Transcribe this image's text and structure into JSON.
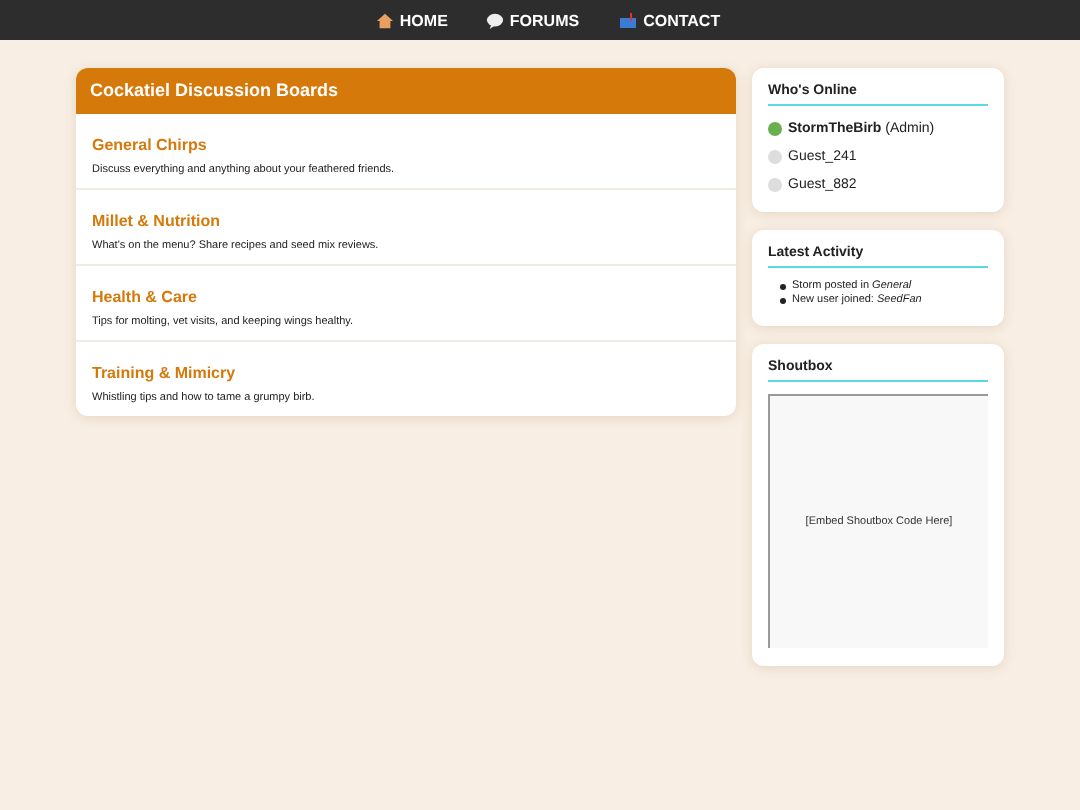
{
  "nav": [
    {
      "kind": "home",
      "label": "HOME"
    },
    {
      "kind": "forums",
      "label": "FORUMS"
    },
    {
      "kind": "contact",
      "label": "CONTACT"
    }
  ],
  "boards": {
    "title": "Cockatiel Discussion Boards",
    "items": [
      {
        "name": "General Chirps",
        "description": "Discuss everything and anything about your feathered friends."
      },
      {
        "name": "Millet & Nutrition",
        "description": "What's on the menu? Share recipes and seed mix reviews."
      },
      {
        "name": "Health & Care",
        "description": "Tips for molting, vet visits, and keeping wings healthy."
      },
      {
        "name": "Training & Mimicry",
        "description": "Whistling tips and how to tame a grumpy birb."
      }
    ]
  },
  "whos_online": {
    "title": "Who's Online",
    "users": [
      {
        "name": "**StormTheBirb** (Admin)",
        "color": "#6ab04c"
      },
      {
        "name": "Guest_241",
        "color": "#dddddd"
      },
      {
        "name": "Guest_882",
        "color": "#dddddd"
      }
    ]
  },
  "latest_activity": {
    "title": "Latest Activity",
    "items": [
      "Storm posted in *General*",
      "New user joined: *SeedFan*"
    ]
  },
  "shoutbox": {
    "title": "Shoutbox",
    "embed_text": "[Embed Shoutbox Code Here]"
  }
}
